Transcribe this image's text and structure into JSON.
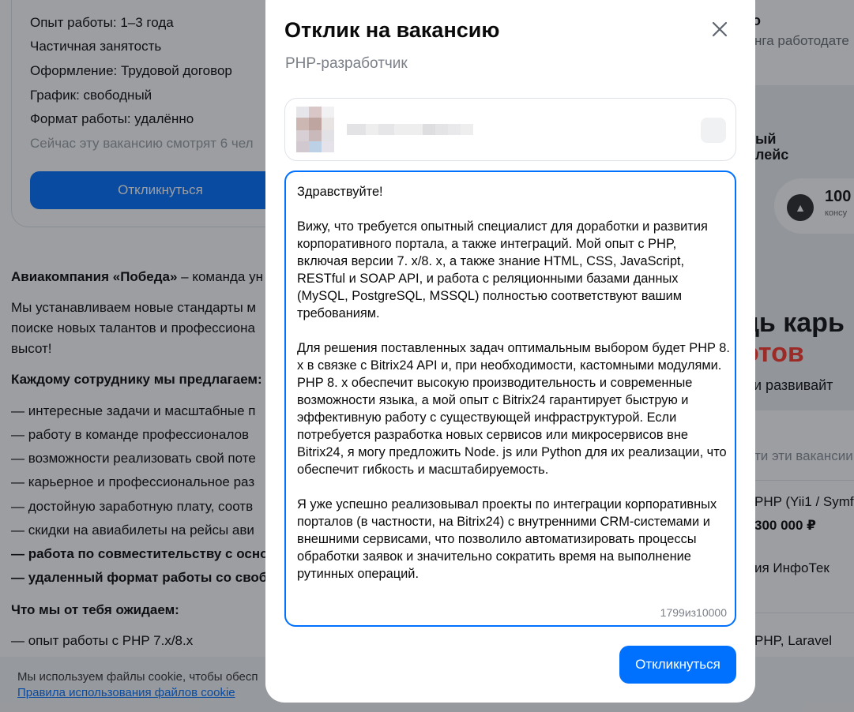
{
  "background": {
    "facts": [
      "Опыт работы: 1–3 года",
      "Частичная занятость",
      "Оформление: Трудовой договор",
      "График: свободный",
      "Формат работы: удалённо"
    ],
    "viewers": "Сейчас эту вакансию смотрят 6 чел",
    "respond_label": "Откликнуться",
    "company_intro_bold": "Авиакомпания «Победа»",
    "company_intro_rest": " – команда ун",
    "company_para": "Мы устанавливаем новые стандарты м поиске новых талантов и профессиона высот!",
    "offer_heading": "Каждому сотруднику мы предлагаем:",
    "offer_items": [
      "— интересные задачи и масштабные п",
      "— работу в команде профессионалов",
      "— возможности реализовать свой поте",
      "— карьерное и профессиональное раз",
      "— достойную заработную плату, соотв",
      "— скидки на авиабилеты на рейсы ави"
    ],
    "offer_bold_items": [
      "— работа по совместительству с осно",
      "— удаленный формат работы со свобо"
    ],
    "expect_heading": "Что мы от тебя ожидаем:",
    "expect_items": [
      "— опыт работы с PHP 7.x/8.x"
    ],
    "right_column": {
      "top_o": "о",
      "top_line": "нга работодате",
      "promo_title": "ый\nлейс",
      "promo_num": "100",
      "promo_small": "консу",
      "promo_big": "ць карь",
      "promo_red": "отов",
      "promo_sub": "у и развивайт",
      "similar": "ти эти вакансии",
      "job1_title": "PHP (Yii1 / Symf",
      "job1_salary": "300 000 ₽",
      "job1_company": "ия ИнфоТек",
      "job2_title": "PHP, Laravel"
    },
    "cookie_text": "Мы используем файлы cookie, чтобы обесп",
    "cookie_link": "Правила использования файлов cookie"
  },
  "modal": {
    "title": "Отклик на вакансию",
    "subtitle": "PHP-разработчик",
    "cover_letter": "Здравствуйте!\n\nВижу, что требуется опытный специалист для доработки и развития корпоративного портала, а также интеграций. Мой опыт с PHP, включая версии 7. x/8. x, а также знание HTML, CSS, JavaScript, RESTful и SOAP API, и работа с реляционными базами данных (MySQL, PostgreSQL, MSSQL) полностью соответствуют вашим требованиям.\n\nДля решения поставленных задач оптимальным выбором будет PHP 8. x в связке с Bitrix24 API и, при необходимости, кастомными модулями. PHP 8. x обеспечит высокую производительность и современные возможности языка, а мой опыт с Bitrix24 гарантирует быструю и эффективную работу с существующей инфраструктурой. Если потребуется разработка новых сервисов или микросервисов вне Bitrix24, я могу предложить Node. js или Python для их реализации, что обеспечит гибкость и масштабируемость.\n\nЯ уже успешно реализовывал проекты по интеграции корпоративных порталов (в частности, на Bitrix24) с внутренними CRM-системами и внешними сервисами, что позволило автоматизировать процессы обработки заявок и значительно сократить время на выполнение рутинных операций.",
    "counter": "1799из10000",
    "submit_label": "Откликнуться"
  },
  "colors": {
    "accent": "#0070ff",
    "promo_red": "#ff3a2f",
    "overlay": "rgba(20,24,32,0.42)"
  },
  "icons": {
    "close": "close-icon",
    "edit": "edit-icon"
  }
}
